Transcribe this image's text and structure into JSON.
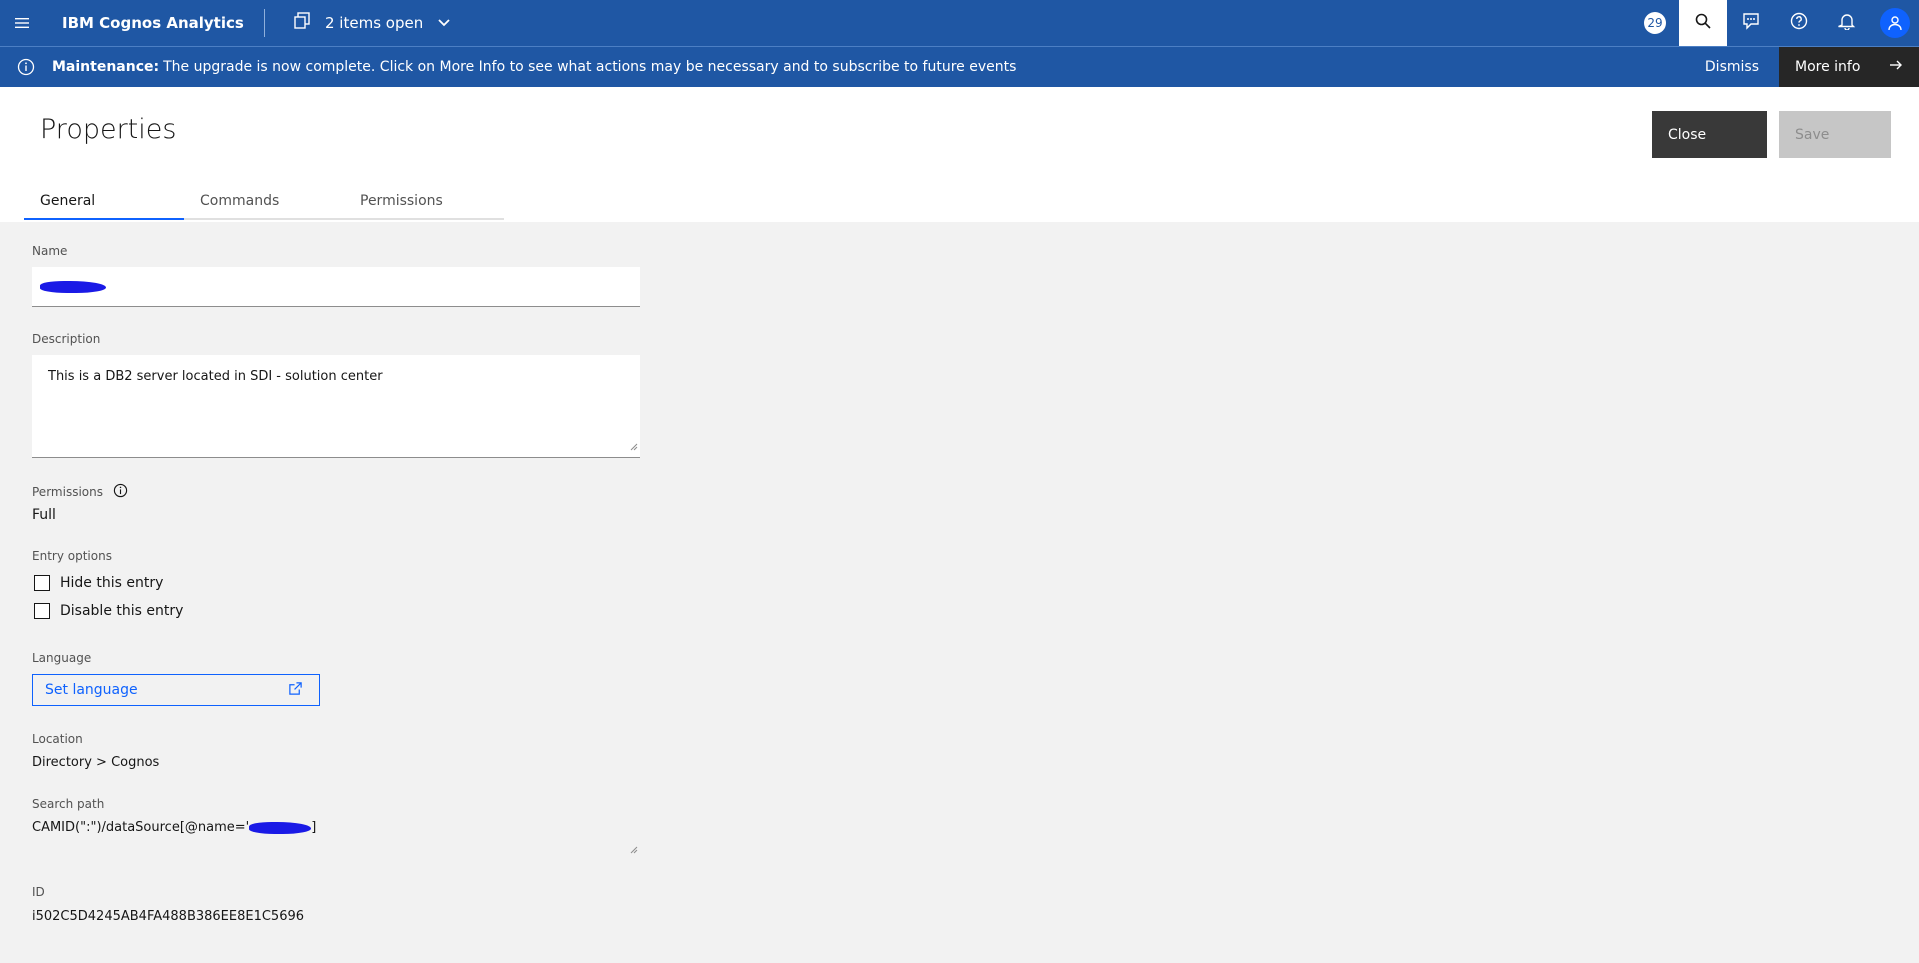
{
  "topbar": {
    "app_title": "IBM Cognos Analytics",
    "items_open": "2 items open",
    "notification_count": "29"
  },
  "banner": {
    "label": "Maintenance:",
    "message": "The upgrade is now complete. Click on More Info to see what actions may be necessary and to subscribe to future events",
    "dismiss": "Dismiss",
    "more_info": "More info"
  },
  "header": {
    "title": "Properties",
    "close_label": "Close",
    "save_label": "Save"
  },
  "tabs": [
    {
      "label": "General",
      "selected": true
    },
    {
      "label": "Commands",
      "selected": false
    },
    {
      "label": "Permissions",
      "selected": false
    }
  ],
  "form": {
    "name_label": "Name",
    "description_label": "Description",
    "description_value": "This is a DB2 server located in SDI - solution center",
    "permissions_label": "Permissions",
    "permissions_value": "Full",
    "entry_options_label": "Entry options",
    "hide_entry": "Hide this entry",
    "disable_entry": "Disable this entry",
    "language_label": "Language",
    "set_language": "Set language",
    "location_label": "Location",
    "location_value": "Directory > Cognos",
    "search_path_label": "Search path",
    "search_path_prefix": "CAMID(\":\")/dataSource[@name='",
    "search_path_suffix": "]",
    "id_label": "ID",
    "id_value": "i502C5D4245AB4FA488B386EE8E1C5696"
  },
  "colors": {
    "brand": "#1f57a4",
    "accent": "#0f62fe",
    "redaction": "#1a1ae6"
  }
}
